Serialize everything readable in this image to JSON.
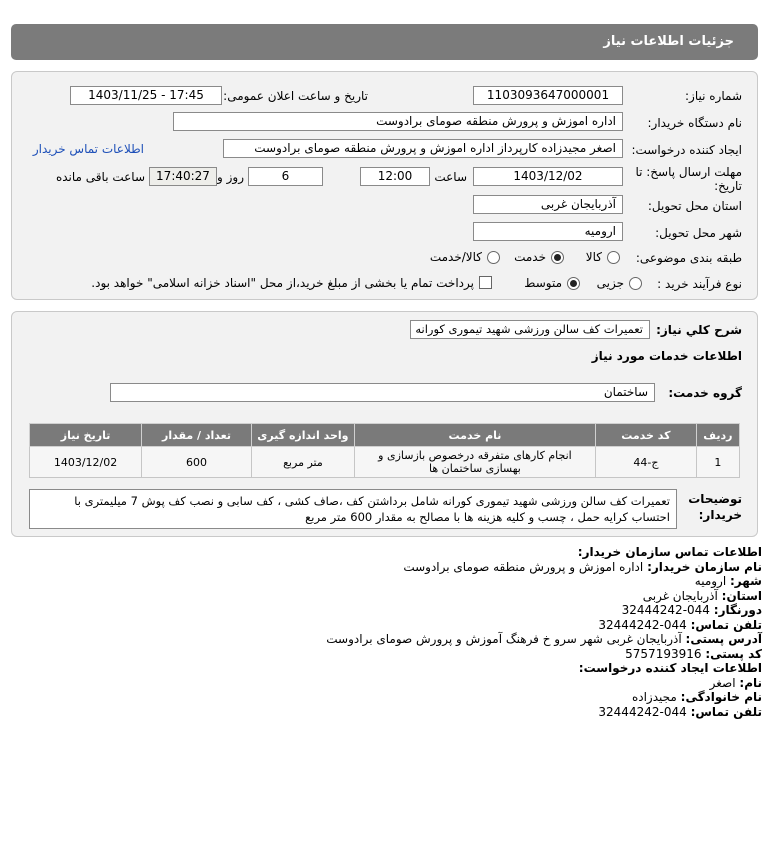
{
  "header": {
    "title": "جزئیات اطلاعات نیاز"
  },
  "form": {
    "need_number_label": "شماره نیاز:",
    "need_number": "1103093647000001",
    "announce_label": "تاریخ و ساعت اعلان عمومی:",
    "announce_value": "1403/11/25 - 17:45",
    "buyer_label": "نام دستگاه خریدار:",
    "buyer_value": "اداره اموزش و پرورش منطقه صومای برادوست",
    "creator_label": "ایجاد کننده درخواست:",
    "creator_value": "اصغر مجیدزاده کارپرداز اداره اموزش و پرورش منطقه صومای برادوست",
    "buyer_contact_link": "اطلاعات تماس خریدار",
    "deadline_label_1": "مهلت ارسال پاسخ: تا",
    "deadline_label_2": "تاریخ:",
    "deadline_date": "1403/12/02",
    "time_label": "ساعت",
    "deadline_time": "12:00",
    "days_value": "6",
    "days_label": "روز و",
    "remaining_time": "17:40:27",
    "remaining_label": "ساعت باقی مانده",
    "province_label": "استان محل تحویل:",
    "province_value": "آذربایجان غربی",
    "city_label": "شهر محل تحویل:",
    "city_value": "ارومیه",
    "category_label": "طبقه بندی موضوعی:",
    "category_options": [
      "کالا",
      "خدمت",
      "کالا/خدمت"
    ],
    "process_label": "نوع فرآیند خرید :",
    "process_options": [
      "جزیی",
      "متوسط"
    ],
    "payment_note": "پرداخت تمام یا بخشی از مبلغ خرید،از محل \"اسناد خزانه اسلامی\" خواهد بود."
  },
  "details": {
    "summary_label": "شرح کلي نياز:",
    "summary_value": "تعمیرات کف سالن ورزشی شهید تیموری کورانه",
    "services_heading": "اطلاعات خدمات مورد نیاز",
    "service_group_label": "گروه خدمت:",
    "service_group_value": "ساختمان",
    "table": {
      "headers": [
        "ردیف",
        "کد خدمت",
        "نام خدمت",
        "واحد اندازه گیری",
        "تعداد / مقدار",
        "تاریخ نیاز"
      ],
      "rows": [
        [
          "1",
          "ج-44",
          "انجام کارهای متفرقه درخصوص بازسازی و بهسازی ساختمان ها",
          "متر مربع",
          "600",
          "1403/12/02"
        ]
      ]
    },
    "buyer_notes_label_1": "توضیحات",
    "buyer_notes_label_2": "خریدار:",
    "buyer_notes": "تعمیرات کف سالن ورزشی شهید تیموری کورانه شامل برداشتن کف ،صاف کشی ، کف سابی و نصب کف پوش 7 میلیمتری با احتساب کرایه حمل ، چسب و کلیه هزینه ها با مصالح به مقدار 600 متر مربع"
  },
  "contact": {
    "org_heading": "اطلاعات تماس سازمان خریدار:",
    "org_name_label": "نام سازمان خریدار:",
    "org_name": "اداره اموزش و پرورش منطقه صومای برادوست",
    "city_label": "شهر:",
    "city": "ارومیه",
    "province_label": "استان:",
    "province": "آذربایجان غربی",
    "fax_label": "دورنگار:",
    "fax": "044-32444242",
    "phone_label": "تلفن تماس:",
    "phone": "044-32444242",
    "address_label": "آدرس پستی:",
    "address": "آذربایجان غربی شهر سرو خ فرهنگ آموزش و پرورش صومای برادوست",
    "postal_label": "کد پستی:",
    "postal": "5757193916",
    "creator_heading": "اطلاعات ایجاد کننده درخواست:",
    "first_name_label": "نام:",
    "first_name": "اصغر",
    "last_name_label": "نام خانوادگی:",
    "last_name": "مجیدزاده",
    "creator_phone_label": "تلفن تماس:",
    "creator_phone": "044-32444242"
  }
}
